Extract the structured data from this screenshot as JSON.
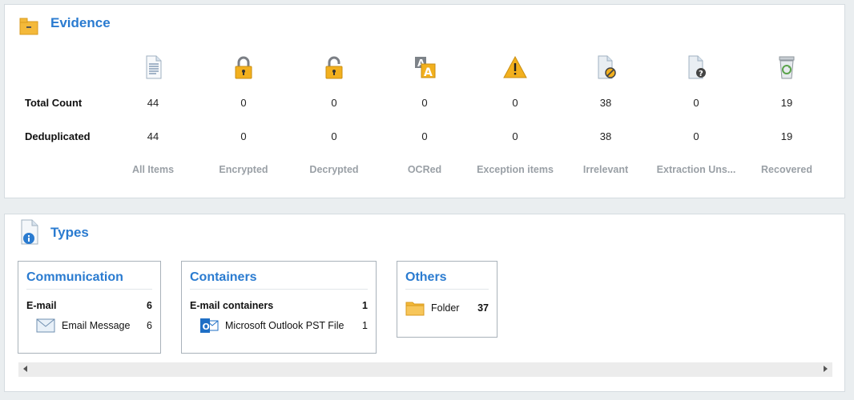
{
  "evidence": {
    "title": "Evidence",
    "rows": [
      "Total Count",
      "Deduplicated"
    ],
    "columns": [
      {
        "label": "All Items",
        "icon": "document-icon",
        "total": "44",
        "dedup": "44"
      },
      {
        "label": "Encrypted",
        "icon": "lock-closed-icon",
        "total": "0",
        "dedup": "0"
      },
      {
        "label": "Decrypted",
        "icon": "lock-open-icon",
        "total": "0",
        "dedup": "0"
      },
      {
        "label": "OCRed",
        "icon": "ocr-icon",
        "total": "0",
        "dedup": "0"
      },
      {
        "label": "Exception items",
        "icon": "warning-icon",
        "total": "0",
        "dedup": "0"
      },
      {
        "label": "Irrelevant",
        "icon": "irrelevant-icon",
        "total": "38",
        "dedup": "38"
      },
      {
        "label": "Extraction Uns...",
        "icon": "unsupported-icon",
        "total": "0",
        "dedup": "0"
      },
      {
        "label": "Recovered",
        "icon": "recycle-bin-icon",
        "total": "19",
        "dedup": "19"
      }
    ]
  },
  "types": {
    "title": "Types",
    "cards": [
      {
        "title": "Communication",
        "category": "E-mail",
        "category_count": "6",
        "items": [
          {
            "label": "Email Message",
            "count": "6",
            "icon": "envelope-icon"
          }
        ]
      },
      {
        "title": "Containers",
        "category": "E-mail containers",
        "category_count": "1",
        "items": [
          {
            "label": "Microsoft Outlook PST File",
            "count": "1",
            "icon": "outlook-icon"
          }
        ]
      },
      {
        "title": "Others",
        "items": [
          {
            "label": "Folder",
            "count": "37",
            "icon": "folder-icon"
          }
        ]
      }
    ]
  },
  "colors": {
    "accent": "#2a7bd0",
    "folder": "#f4b93a",
    "warning": "#f2b01e"
  }
}
